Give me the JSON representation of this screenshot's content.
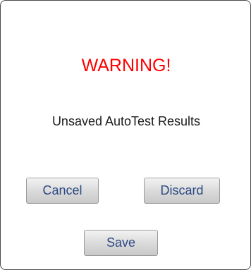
{
  "dialog": {
    "title": "WARNING!",
    "title_color": "#ff0000",
    "message": "Unsaved AutoTest Results",
    "buttons": {
      "cancel": "Cancel",
      "discard": "Discard",
      "save": "Save"
    },
    "button_text_color": "#2b4a84"
  }
}
